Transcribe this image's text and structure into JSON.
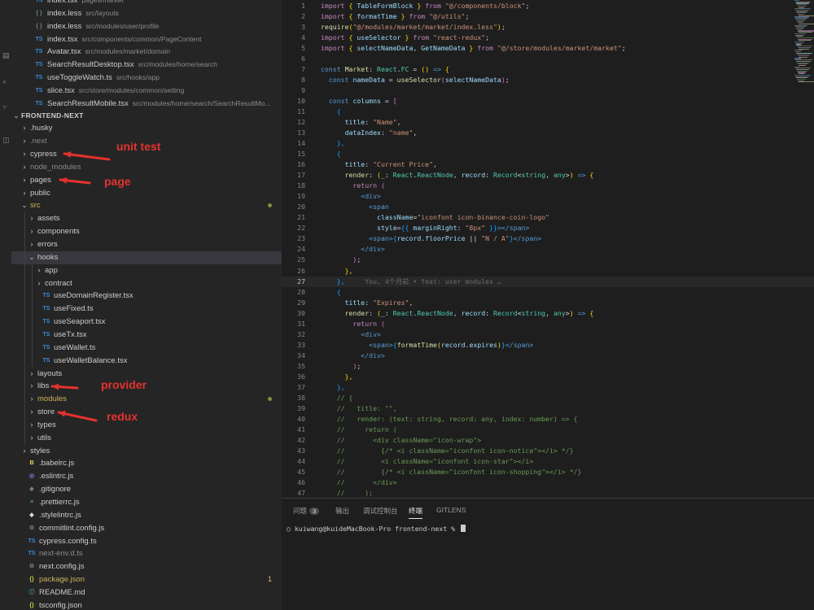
{
  "sidebar": {
    "open_editors": [
      {
        "name": "index.tsx",
        "path": "pages/market",
        "icon": "ts",
        "kind": "tsx",
        "partial": true
      },
      {
        "name": "index.less",
        "path": "src/layouts",
        "icon": "{}",
        "kind": "less"
      },
      {
        "name": "index.less",
        "path": "src/modules/user/profile",
        "icon": "{}",
        "kind": "less"
      },
      {
        "name": "index.tsx",
        "path": "src/components/common/PageContent",
        "icon": "TS",
        "kind": "tsx"
      },
      {
        "name": "Avatar.tsx",
        "path": "src/modules/market/domain",
        "icon": "TS",
        "kind": "tsx"
      },
      {
        "name": "SearchResultDesktop.tsx",
        "path": "src/modules/home/search",
        "icon": "TS",
        "kind": "tsx"
      },
      {
        "name": "useToggleWatch.ts",
        "path": "src/hooks/app",
        "icon": "TS",
        "kind": "ts"
      },
      {
        "name": "slice.tsx",
        "path": "src/store/modules/common/setting",
        "icon": "TS",
        "kind": "tsx"
      },
      {
        "name": "SearchResultMobile.tsx",
        "path": "src/modules/home/search/SearchResultMo...",
        "icon": "TS",
        "kind": "tsx"
      }
    ],
    "project_title": "FRONTEND-NEXT",
    "tree": [
      {
        "name": ".husky",
        "depth": 0,
        "type": "folder",
        "state": "closed"
      },
      {
        "name": ".next",
        "depth": 0,
        "type": "folder",
        "state": "closed",
        "dim": true
      },
      {
        "name": "cypress",
        "depth": 0,
        "type": "folder",
        "state": "closed"
      },
      {
        "name": "node_modules",
        "depth": 0,
        "type": "folder",
        "state": "closed",
        "dim": true
      },
      {
        "name": "pages",
        "depth": 0,
        "type": "folder",
        "state": "closed"
      },
      {
        "name": "public",
        "depth": 0,
        "type": "folder",
        "state": "closed"
      },
      {
        "name": "src",
        "depth": 0,
        "type": "folder",
        "state": "open",
        "color": "#c9b458",
        "dot": true
      },
      {
        "name": "assets",
        "depth": 1,
        "type": "folder",
        "state": "closed"
      },
      {
        "name": "components",
        "depth": 1,
        "type": "folder",
        "state": "closed"
      },
      {
        "name": "errors",
        "depth": 1,
        "type": "folder",
        "state": "closed"
      },
      {
        "name": "hooks",
        "depth": 1,
        "type": "folder",
        "state": "open",
        "active": true
      },
      {
        "name": "app",
        "depth": 2,
        "type": "folder",
        "state": "closed"
      },
      {
        "name": "contract",
        "depth": 2,
        "type": "folder",
        "state": "closed"
      },
      {
        "name": "useDomainRegister.tsx",
        "depth": 2,
        "type": "ts"
      },
      {
        "name": "useFixed.ts",
        "depth": 2,
        "type": "ts"
      },
      {
        "name": "useSeaport.tsx",
        "depth": 2,
        "type": "ts"
      },
      {
        "name": "useTx.tsx",
        "depth": 2,
        "type": "ts"
      },
      {
        "name": "useWallet.ts",
        "depth": 2,
        "type": "ts"
      },
      {
        "name": "useWalletBalance.tsx",
        "depth": 2,
        "type": "ts"
      },
      {
        "name": "layouts",
        "depth": 1,
        "type": "folder",
        "state": "closed"
      },
      {
        "name": "libs",
        "depth": 1,
        "type": "folder",
        "state": "closed"
      },
      {
        "name": "modules",
        "depth": 1,
        "type": "folder",
        "state": "closed",
        "color": "#c9b458",
        "dot": true
      },
      {
        "name": "store",
        "depth": 1,
        "type": "folder",
        "state": "closed"
      },
      {
        "name": "types",
        "depth": 1,
        "type": "folder",
        "state": "closed"
      },
      {
        "name": "utils",
        "depth": 1,
        "type": "folder",
        "state": "closed"
      },
      {
        "name": "styles",
        "depth": 0,
        "type": "folder",
        "state": "closed"
      },
      {
        "name": ".babelrc.js",
        "depth": 0,
        "type": "babel"
      },
      {
        "name": ".eslintrc.js",
        "depth": 0,
        "type": "eslint"
      },
      {
        "name": ".gitignore",
        "depth": 0,
        "type": "git"
      },
      {
        "name": ".prettierrc.js",
        "depth": 0,
        "type": "prettier"
      },
      {
        "name": ".stylelintrc.js",
        "depth": 0,
        "type": "stylelint"
      },
      {
        "name": "commitlint.config.js",
        "depth": 0,
        "type": "config"
      },
      {
        "name": "cypress.config.ts",
        "depth": 0,
        "type": "ts"
      },
      {
        "name": "next-env.d.ts",
        "depth": 0,
        "type": "ts",
        "dim": true
      },
      {
        "name": "next.config.js",
        "depth": 0,
        "type": "config"
      },
      {
        "name": "package.json",
        "depth": 0,
        "type": "json",
        "color": "#c9b458",
        "badge": "1"
      },
      {
        "name": "README.md",
        "depth": 0,
        "type": "md"
      },
      {
        "name": "tsconfig.json",
        "depth": 0,
        "type": "json"
      }
    ]
  },
  "annotations": [
    {
      "text": "unit test",
      "target": "cypress"
    },
    {
      "text": "page",
      "target": "pages"
    },
    {
      "text": "provider",
      "target": "libs"
    },
    {
      "text": "redux",
      "target": "store"
    }
  ],
  "editor": {
    "current_line": 27,
    "blame": "You, 4个月前 • feat: user modules …",
    "lines": [
      [
        [
          "import ",
          "kw"
        ],
        [
          "{ ",
          "br"
        ],
        [
          "TableFormBlock ",
          "var"
        ],
        [
          "} ",
          "br"
        ],
        [
          "from ",
          "kw"
        ],
        [
          "\"@/components/block\"",
          "str"
        ],
        [
          ";",
          ""
        ]
      ],
      [
        [
          "import ",
          "kw"
        ],
        [
          "{ ",
          "br"
        ],
        [
          "formatTime ",
          "var"
        ],
        [
          "} ",
          "br"
        ],
        [
          "from ",
          "kw"
        ],
        [
          "\"@/utils\"",
          "str"
        ],
        [
          ";",
          ""
        ]
      ],
      [
        [
          "require",
          "fn"
        ],
        [
          "(",
          "br"
        ],
        [
          "\"@/modules/market/market/index.less\"",
          "str"
        ],
        [
          ")",
          "br"
        ],
        [
          ";",
          ""
        ]
      ],
      [
        [
          "import ",
          "kw"
        ],
        [
          "{ ",
          "br"
        ],
        [
          "useSelector ",
          "var"
        ],
        [
          "} ",
          "br"
        ],
        [
          "from ",
          "kw"
        ],
        [
          "\"react-redux\"",
          "str"
        ],
        [
          ";",
          ""
        ]
      ],
      [
        [
          "import ",
          "kw"
        ],
        [
          "{ ",
          "br"
        ],
        [
          "selectNameData",
          "var"
        ],
        [
          ", ",
          ""
        ],
        [
          "GetNameData ",
          "var"
        ],
        [
          "} ",
          "br"
        ],
        [
          "from ",
          "kw"
        ],
        [
          "\"@/store/modules/market/market\"",
          "str"
        ],
        [
          ";",
          ""
        ]
      ],
      [],
      [
        [
          "const ",
          "key"
        ],
        [
          "Market",
          "fn"
        ],
        [
          ": ",
          ""
        ],
        [
          "React",
          "type"
        ],
        [
          ".",
          ""
        ],
        [
          "FC",
          "type"
        ],
        [
          " = ",
          ""
        ],
        [
          "() ",
          "br"
        ],
        [
          "=> ",
          "key"
        ],
        [
          "{",
          "br"
        ]
      ],
      [
        [
          "  const ",
          "key"
        ],
        [
          "nameData",
          "var"
        ],
        [
          " = ",
          ""
        ],
        [
          "useSelector",
          "fn"
        ],
        [
          "(",
          "br2"
        ],
        [
          "selectNameData",
          "var"
        ],
        [
          ")",
          "br2"
        ],
        [
          ";",
          ""
        ]
      ],
      [],
      [
        [
          "  const ",
          "key"
        ],
        [
          "columns",
          "var"
        ],
        [
          " = ",
          ""
        ],
        [
          "[",
          "br2"
        ]
      ],
      [
        [
          "    {",
          "br3"
        ]
      ],
      [
        [
          "      title",
          "var"
        ],
        [
          ": ",
          ""
        ],
        [
          "\"Name\"",
          "str"
        ],
        [
          ",",
          ""
        ]
      ],
      [
        [
          "      dataIndex",
          "var"
        ],
        [
          ": ",
          ""
        ],
        [
          "\"name\"",
          "str"
        ],
        [
          ",",
          ""
        ]
      ],
      [
        [
          "    },",
          "br3"
        ]
      ],
      [
        [
          "    {",
          "br3"
        ]
      ],
      [
        [
          "      title",
          "var"
        ],
        [
          ": ",
          ""
        ],
        [
          "\"Current Price\"",
          "str"
        ],
        [
          ",",
          ""
        ]
      ],
      [
        [
          "      render",
          "fn"
        ],
        [
          ": ",
          ""
        ],
        [
          "(",
          "br"
        ],
        [
          "_",
          "var"
        ],
        [
          ": ",
          ""
        ],
        [
          "React",
          "type"
        ],
        [
          ".",
          ""
        ],
        [
          "ReactNode",
          "type"
        ],
        [
          ", ",
          ""
        ],
        [
          "record",
          "var"
        ],
        [
          ": ",
          ""
        ],
        [
          "Record",
          "type"
        ],
        [
          "<",
          ""
        ],
        [
          "string",
          "type"
        ],
        [
          ", ",
          ""
        ],
        [
          "any",
          "type"
        ],
        [
          ">",
          ""
        ],
        [
          ") ",
          "br"
        ],
        [
          "=> ",
          "key"
        ],
        [
          "{",
          "br"
        ]
      ],
      [
        [
          "        return ",
          "kw"
        ],
        [
          "(",
          "br2"
        ]
      ],
      [
        [
          "          <",
          "tag"
        ],
        [
          "div",
          "tag"
        ],
        [
          ">",
          "tag"
        ]
      ],
      [
        [
          "            <",
          "tag"
        ],
        [
          "span",
          "tag"
        ]
      ],
      [
        [
          "              className",
          "attr"
        ],
        [
          "=",
          ""
        ],
        [
          "\"iconfont icon-binance-coin-logo\"",
          "str"
        ]
      ],
      [
        [
          "              style",
          "attr"
        ],
        [
          "=",
          ""
        ],
        [
          "{{ ",
          "br3"
        ],
        [
          "marginRight",
          "var"
        ],
        [
          ": ",
          ""
        ],
        [
          "\"8px\"",
          "str"
        ],
        [
          " }}",
          "br3"
        ],
        [
          "></",
          "tag"
        ],
        [
          "span",
          "tag"
        ],
        [
          ">",
          "tag"
        ]
      ],
      [
        [
          "            <",
          "tag"
        ],
        [
          "span",
          "tag"
        ],
        [
          ">",
          "tag"
        ],
        [
          "{",
          "br3"
        ],
        [
          "record",
          "var"
        ],
        [
          ".",
          ""
        ],
        [
          "floorPrice",
          "var"
        ],
        [
          " || ",
          ""
        ],
        [
          "\"N / A\"",
          "str"
        ],
        [
          "}",
          "br3"
        ],
        [
          "</",
          "tag"
        ],
        [
          "span",
          "tag"
        ],
        [
          ">",
          "tag"
        ]
      ],
      [
        [
          "          </",
          "tag"
        ],
        [
          "div",
          "tag"
        ],
        [
          ">",
          "tag"
        ]
      ],
      [
        [
          "        ",
          ""
        ],
        [
          ")",
          "br2"
        ],
        [
          ";",
          ""
        ]
      ],
      [
        [
          "      },",
          "br"
        ]
      ],
      [
        [
          "    },",
          "br3"
        ],
        [
          "     ",
          ""
        ],
        [
          "BLAME",
          "ghost"
        ]
      ],
      [
        [
          "    {",
          "br3"
        ]
      ],
      [
        [
          "      title",
          "var"
        ],
        [
          ": ",
          ""
        ],
        [
          "\"Expires\"",
          "str"
        ],
        [
          ",",
          ""
        ]
      ],
      [
        [
          "      render",
          "fn"
        ],
        [
          ": ",
          ""
        ],
        [
          "(",
          "br"
        ],
        [
          "_",
          "var"
        ],
        [
          ": ",
          ""
        ],
        [
          "React",
          "type"
        ],
        [
          ".",
          ""
        ],
        [
          "ReactNode",
          "type"
        ],
        [
          ", ",
          ""
        ],
        [
          "record",
          "var"
        ],
        [
          ": ",
          ""
        ],
        [
          "Record",
          "type"
        ],
        [
          "<",
          ""
        ],
        [
          "string",
          "type"
        ],
        [
          ", ",
          ""
        ],
        [
          "any",
          "type"
        ],
        [
          ">",
          ""
        ],
        [
          ") ",
          "br"
        ],
        [
          "=> ",
          "key"
        ],
        [
          "{",
          "br"
        ]
      ],
      [
        [
          "        return ",
          "kw"
        ],
        [
          "(",
          "br2"
        ]
      ],
      [
        [
          "          <",
          "tag"
        ],
        [
          "div",
          "tag"
        ],
        [
          ">",
          "tag"
        ]
      ],
      [
        [
          "            <",
          "tag"
        ],
        [
          "span",
          "tag"
        ],
        [
          ">",
          "tag"
        ],
        [
          "{",
          "br3"
        ],
        [
          "formatTime",
          "fn"
        ],
        [
          "(",
          "br"
        ],
        [
          "record",
          "var"
        ],
        [
          ".",
          ""
        ],
        [
          "expires",
          "var"
        ],
        [
          ")",
          "br"
        ],
        [
          "}",
          "br3"
        ],
        [
          "</",
          "tag"
        ],
        [
          "span",
          "tag"
        ],
        [
          ">",
          "tag"
        ]
      ],
      [
        [
          "          </",
          "tag"
        ],
        [
          "div",
          "tag"
        ],
        [
          ">",
          "tag"
        ]
      ],
      [
        [
          "        ",
          ""
        ],
        [
          ")",
          "br2"
        ],
        [
          ";",
          ""
        ]
      ],
      [
        [
          "      },",
          "br"
        ]
      ],
      [
        [
          "    },",
          "br3"
        ]
      ],
      [
        [
          "    // {",
          "cm"
        ]
      ],
      [
        [
          "    //   title: \"\",",
          "cm"
        ]
      ],
      [
        [
          "    //   render: (text: string, record: any, index: number) => {",
          "cm"
        ]
      ],
      [
        [
          "    //     return (",
          "cm"
        ]
      ],
      [
        [
          "    //       <div className=\"icon-wrap\">",
          "cm"
        ]
      ],
      [
        [
          "    //         {/* <i className=\"iconfont icon-notice\"></i> */}",
          "cm"
        ]
      ],
      [
        [
          "    //         <i className=\"iconfont icon-star\"></i>",
          "cm"
        ]
      ],
      [
        [
          "    //         {/* <i className=\"iconfont icon-shopping\"></i> */}",
          "cm"
        ]
      ],
      [
        [
          "    //       </div>",
          "cm"
        ]
      ],
      [
        [
          "    //     );",
          "cm"
        ]
      ]
    ]
  },
  "panel": {
    "tabs": [
      {
        "label": "问题",
        "badge": "3"
      },
      {
        "label": "输出"
      },
      {
        "label": "调试控制台"
      },
      {
        "label": "终端",
        "active": true
      },
      {
        "label": "GITLENS"
      }
    ],
    "terminal_prompt": "○ kuiwang@kuideMacBook-Pro frontend-next % "
  },
  "colors": {
    "annotation": "#e5322d",
    "ts_icon": "#3b8bd6",
    "json_icon": "#cbcb41",
    "modified": "#c9b458"
  }
}
